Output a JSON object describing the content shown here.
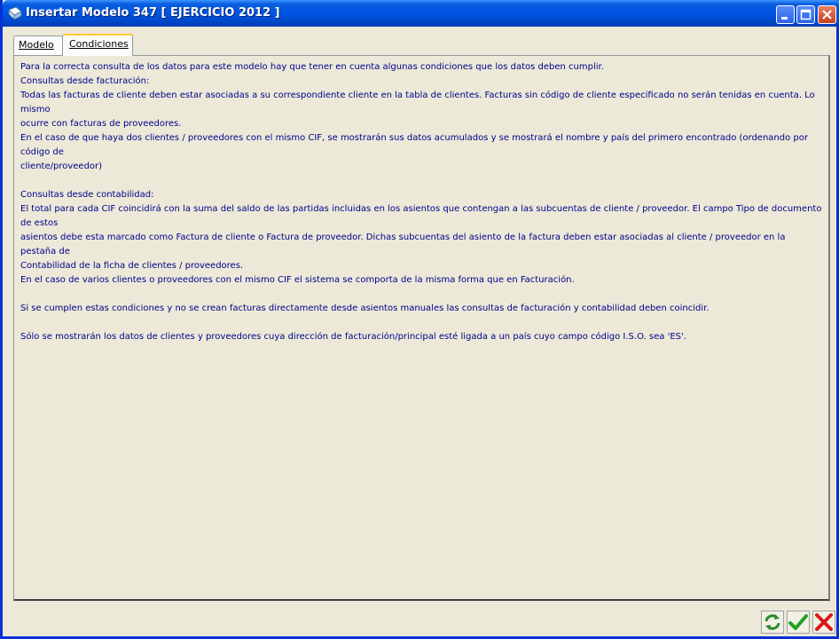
{
  "window": {
    "title": "Insertar Modelo 347 [ EJERCICIO 2012 ]"
  },
  "tabs": [
    {
      "label": "Modelo",
      "active": false
    },
    {
      "label": "Condiciones",
      "active": true
    }
  ],
  "content": {
    "intro": "Para la correcta consulta de los datos para este modelo hay que tener en cuenta algunas condiciones que los datos deben cumplir.",
    "facturacion_heading": "Consultas desde facturación:",
    "facturacion_p1_line1": "Todas las facturas de cliente deben estar asociadas a su correspondiente cliente en la tabla de clientes. Facturas sin código de cliente especificado no serán tenidas en cuenta. Lo mismo",
    "facturacion_p1_line2": "ocurre con facturas de proveedores.",
    "facturacion_p2_line1": "En el caso de que haya dos clientes / proveedores con el mismo CIF, se mostrarán sus datos acumulados y se mostrará el nombre y país del primero encontrado (ordenando por código de",
    "facturacion_p2_line2": "cliente/proveedor)",
    "contabilidad_heading": "Consultas desde contabilidad:",
    "contabilidad_p1_line1": "El total para cada CIF coincidirá con la suma del saldo de las partidas incluidas en los asientos que contengan a las subcuentas de cliente / proveedor. El campo Tipo de documento de estos",
    "contabilidad_p1_line2": "asientos debe esta marcado como Factura de cliente o Factura de proveedor. Dichas subcuentas del asiento de la factura deben estar asociadas al cliente / proveedor en la pestaña de",
    "contabilidad_p1_line3": "Contabilidad de la ficha de clientes / proveedores.",
    "contabilidad_p2": "En el caso de varios clientes o proveedores con el mismo CIF el sistema se comporta de la misma forma que en Facturación.",
    "coincidir": "Si se cumplen estas condiciones y no se crean facturas directamente desde asientos manuales las consultas de facturación y contabilidad deben coincidir.",
    "solo_es": "Sólo se mostrarán los datos de clientes y proveedores cuya dirección de facturación/principal esté ligada a un país cuyo campo código I.S.O. sea 'ES'."
  },
  "colors": {
    "text": "#00008b",
    "titlebar": "#0054e3",
    "background": "#ece9d8"
  },
  "icons": {
    "app": "app-icon",
    "minimize": "minimize-icon",
    "maximize": "maximize-icon",
    "close": "close-icon",
    "refresh": "refresh-icon",
    "accept": "check-icon",
    "cancel": "cancel-icon"
  }
}
